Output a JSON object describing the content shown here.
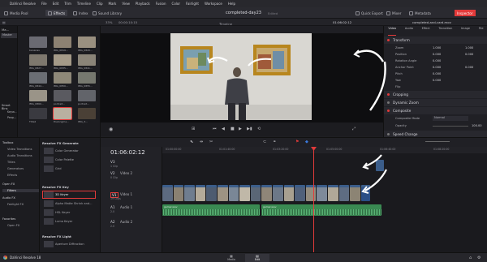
{
  "menubar": {
    "items": [
      "DaVinci Resolve",
      "File",
      "Edit",
      "Trim",
      "Timeline",
      "Clip",
      "Mark",
      "View",
      "Playback",
      "Fusion",
      "Color",
      "Fairlight",
      "Workspace",
      "Help"
    ]
  },
  "toolbar": {
    "media_pool": "Media Pool",
    "effects": "Effects",
    "index": "Index",
    "sound_library": "Sound Library",
    "project_title": "completed-day23",
    "edited": "Edited",
    "quick_export": "Quick Export",
    "mixer": "Mixer",
    "metadata": "Metadata",
    "inspector": "Inspector"
  },
  "strip": {
    "zoom": "33%",
    "timecode_left": "00:00:10:15",
    "timeline_name": "Timeline 1",
    "timecode_right": "01:06:02:12",
    "clip_name": "completed-and-card.mov"
  },
  "media_pool": {
    "bins_header": "Ma...",
    "master": "Master",
    "smart_bins": "Smart Bins",
    "smart_items": [
      "Keyw...",
      "Peop..."
    ],
    "clips": [
      {
        "label": "bananas",
        "color": "#6a6a72"
      },
      {
        "label": "IMG_0819...",
        "color": "#8c8172"
      },
      {
        "label": "IMG_0820...",
        "color": "#9a9080"
      },
      {
        "label": "IMG_0827...",
        "color": "#7e786e"
      },
      {
        "label": "IMG_0835...",
        "color": "#a49a88"
      },
      {
        "label": "IMG_0841...",
        "color": "#8a8478"
      },
      {
        "label": "IMG_0844...",
        "color": "#6b6e74"
      },
      {
        "label": "IMG_0850...",
        "color": "#8e8878"
      },
      {
        "label": "IMG_0855...",
        "color": "#76786f"
      },
      {
        "label": "IMG_0860...",
        "color": "#9a9488"
      },
      {
        "label": "portrait...",
        "color": "#5a5a60"
      },
      {
        "label": "portrait...",
        "color": "#62646a"
      },
      {
        "label": "Title2",
        "color": "#3a3a40"
      },
      {
        "label": "thelongme...",
        "color": "#b9b0a0"
      },
      {
        "label": "IMG_3...",
        "color": "#4a4036"
      }
    ]
  },
  "inspector": {
    "tabs": [
      "Video",
      "Audio",
      "Effect",
      "Transition",
      "Image",
      "File"
    ],
    "transform": "Transform",
    "rows": [
      {
        "label": "Zoom",
        "x": "1.000",
        "y": "1.000"
      },
      {
        "label": "Position",
        "x": "0.000",
        "y": "0.000"
      },
      {
        "label": "Rotation Angle",
        "x": "0.000",
        "y": ""
      },
      {
        "label": "Anchor Point",
        "x": "0.000",
        "y": "0.000"
      },
      {
        "label": "Pitch",
        "x": "0.000",
        "y": ""
      },
      {
        "label": "Yaw",
        "x": "0.000",
        "y": ""
      },
      {
        "label": "Flip",
        "x": "",
        "y": ""
      }
    ],
    "cropping": "Cropping",
    "dynamic_zoom": "Dynamic Zoom",
    "composite": "Composite",
    "composite_mode_label": "Composite Mode",
    "composite_mode_value": "Normal",
    "opacity_label": "Opacity",
    "opacity_value": "100.00",
    "speed_change": "Speed Change"
  },
  "effects": {
    "toolbox": [
      "Toolbox",
      "Video Transitions",
      "Audio Transitions",
      "Titles",
      "Generators",
      "Effects"
    ],
    "openfx": "Open FX",
    "filters": "Filters",
    "audiofx": "Audio FX",
    "fairlightfx": "Fairlight FX",
    "favorites": "Favorites",
    "favorites_item": "Open FX",
    "headers": [
      "Resolve FX Generate",
      "Resolve FX Key",
      "Resolve FX Light"
    ],
    "generate_items": [
      "Color Generator",
      "Color Palette",
      "Grid"
    ],
    "key_items": [
      "3D Keyer",
      "Alpha Matte Shrink and...",
      "HSL Keyer",
      "Luma Keyer"
    ],
    "light_items": [
      "Aperture Diffraction"
    ],
    "selected_item": "3D Keyer"
  },
  "timeline": {
    "timecode": "01:06:02:12",
    "ruler_marks": [
      "01:00:00:00",
      "01:01:40:00",
      "01:03:20:00",
      "01:05:00:00",
      "01:06:40:00",
      "01:08:20:00"
    ],
    "tracks": [
      {
        "id": "V3",
        "name": "",
        "sub": "1 Clip"
      },
      {
        "id": "V2",
        "name": "Video 2",
        "sub": "0 Clip"
      },
      {
        "id": "V1",
        "name": "Video 1",
        "sub": "19 Clips"
      },
      {
        "id": "A1",
        "name": "Audio 1",
        "sub": "2.0"
      },
      {
        "id": "A2",
        "name": "Audio 2",
        "sub": "2.0"
      }
    ],
    "audio_clip_labels": [
      "gamer.wav",
      "gamer.wav"
    ]
  },
  "bottom": {
    "app_name": "DaVinci Resolve 18",
    "pages": [
      "Media",
      "Edit"
    ],
    "active_page": "Edit"
  },
  "colors": {
    "accent": "#e23a3a",
    "playhead": "#e23a3a",
    "audio_clip": "#3a8a52",
    "video_clip": "#3b5d8a"
  }
}
